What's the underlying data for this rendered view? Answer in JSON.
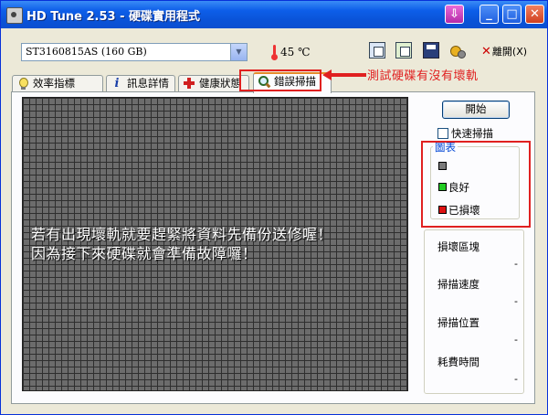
{
  "window": {
    "title": "HD Tune 2.53 - 硬碟實用程式",
    "controls": {
      "tray": "⇩",
      "minimize": "_",
      "maximize": "□",
      "close": "✕"
    }
  },
  "toolbar": {
    "drive": "ST3160815AS (160 GB)",
    "temperature": "45 ℃",
    "exit_label": "離開(X)",
    "exit_prefix": "✕"
  },
  "tabs": [
    {
      "label": "效率指標",
      "icon": "lightbulb-icon"
    },
    {
      "label": "訊息詳情",
      "icon": "info-icon",
      "glyph": "i"
    },
    {
      "label": "健康狀態",
      "icon": "health-cross-icon"
    },
    {
      "label": "錯誤掃描",
      "icon": "magnifier-icon",
      "active": true
    }
  ],
  "annotations": {
    "tab_note": "測試硬碟有沒有壞軌",
    "overlay_line1": "若有出現壞軌就要趕緊將資料先備份送修喔！",
    "overlay_line2": "因為接下來硬碟就會準備故障囉！"
  },
  "scan": {
    "start_label": "開始",
    "quick_scan_label": "快速掃描",
    "quick_scan_checked": false
  },
  "legend": {
    "title": "圖表",
    "items": [
      {
        "label": "",
        "color": "#7a7a7a"
      },
      {
        "label": "良好",
        "color": "#22cc22"
      },
      {
        "label": "已損壞",
        "color": "#dd1111"
      }
    ]
  },
  "stats": [
    {
      "label": "損壞區塊",
      "value": "-"
    },
    {
      "label": "掃描速度",
      "value": "-"
    },
    {
      "label": "掃描位置",
      "value": "-"
    },
    {
      "label": "耗費時間",
      "value": "-"
    }
  ],
  "colors": {
    "accent": "#e02020",
    "title_bar": "#0a53d8",
    "grid_block": "#6c6c6c"
  }
}
